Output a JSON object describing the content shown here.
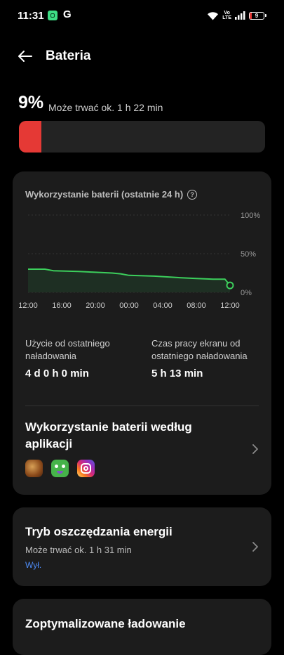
{
  "status_bar": {
    "time": "11:31",
    "notif_g": "G",
    "volte_top": "Vo",
    "volte_bottom": "LTE",
    "battery_level": "9"
  },
  "header": {
    "title": "Bateria"
  },
  "battery": {
    "percent": "9%",
    "estimate": "Może trwać ok. 1 h 22 min",
    "level_fraction": 0.09,
    "fill_color": "#e53935"
  },
  "usage": {
    "heading": "Wykorzystanie baterii (ostatnie 24 h)",
    "help_glyph": "?",
    "chart_data": {
      "type": "area",
      "x_ticks": [
        "12:00",
        "16:00",
        "20:00",
        "00:00",
        "04:00",
        "08:00",
        "12:00"
      ],
      "y_ticks": [
        "100%",
        "50%",
        "0%"
      ],
      "ylim": [
        0,
        100
      ],
      "line_color": "#3ccf5c",
      "series": [
        {
          "values": [
            {
              "x": 0,
              "y": 30
            },
            {
              "x": 2,
              "y": 30
            },
            {
              "x": 3,
              "y": 28
            },
            {
              "x": 6,
              "y": 27
            },
            {
              "x": 8,
              "y": 26
            },
            {
              "x": 10,
              "y": 25
            },
            {
              "x": 11,
              "y": 24
            },
            {
              "x": 12,
              "y": 22
            },
            {
              "x": 15,
              "y": 21
            },
            {
              "x": 18,
              "y": 19
            },
            {
              "x": 20,
              "y": 18
            },
            {
              "x": 22,
              "y": 17
            },
            {
              "x": 23.4,
              "y": 17
            },
            {
              "x": 24,
              "y": 9
            }
          ]
        }
      ]
    },
    "stat_since_charge_label": "Użycie od ostatniego naładowania",
    "stat_since_charge_value": "4 d 0 h 0 min",
    "stat_screen_label": "Czas pracy ekranu od ostatniego naładowania",
    "stat_screen_value": "5 h 13 min",
    "apps_title": "Wykorzystanie baterii według aplikacji",
    "apps": [
      "game-app-icon",
      "duolingo-icon",
      "instagram-icon"
    ]
  },
  "power_saving": {
    "title": "Tryb oszczędzania energii",
    "estimate": "Może trwać ok. 1 h 31 min",
    "state": "Wył."
  },
  "optimized_charging": {
    "title": "Zoptymalizowane ładowanie"
  }
}
